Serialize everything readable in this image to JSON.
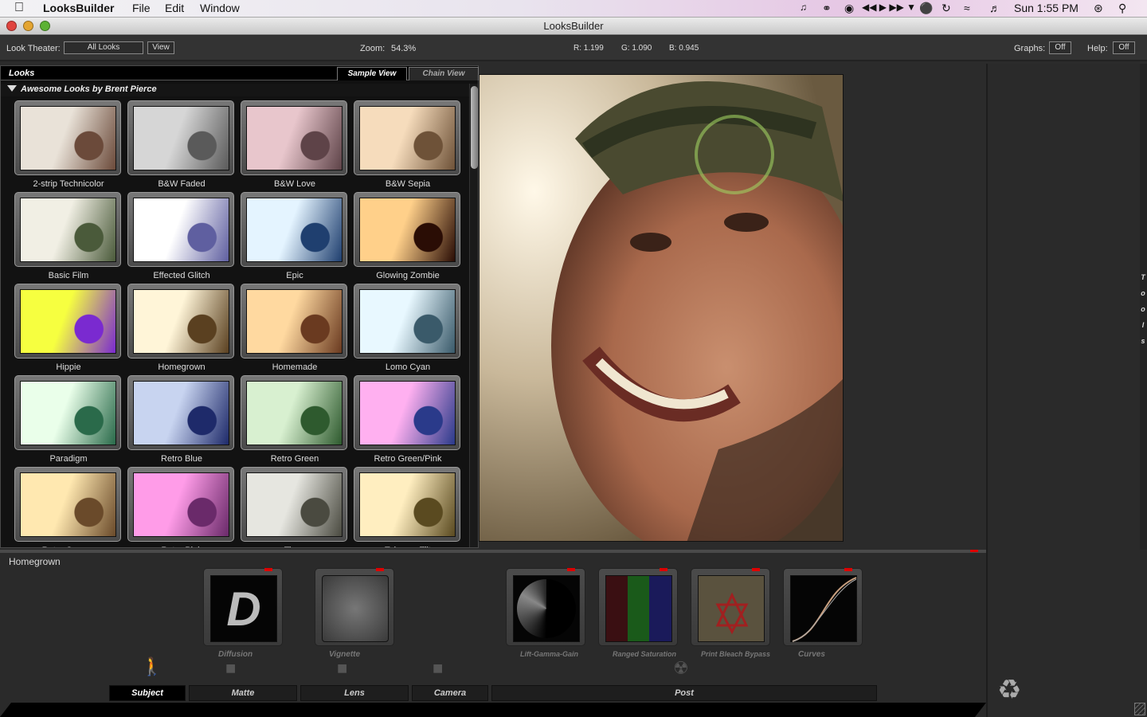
{
  "menubar": {
    "app_name": "LooksBuilder",
    "menus": [
      "File",
      "Edit",
      "Window"
    ],
    "clock": "Sun 1:55 PM"
  },
  "window": {
    "title": "LooksBuilder"
  },
  "toolbar": {
    "look_theater_label": "Look Theater:",
    "look_theater_value": "All Looks",
    "view_button": "View",
    "zoom_label": "Zoom:",
    "zoom_value": "54.3%",
    "r": "R: 1.199",
    "g": "G: 1.090",
    "b": "B: 0.945",
    "graphs_label": "Graphs:",
    "graphs_value": "Off",
    "help_label": "Help:",
    "help_value": "Off"
  },
  "looks_panel": {
    "title": "Looks",
    "tabs": [
      "Sample View",
      "Chain View"
    ],
    "active_tab": "Sample View",
    "group_title": "Awesome Looks by Brent Pierce",
    "looks": [
      {
        "name": "2-strip Technicolor",
        "c1": "#e9e2d8",
        "c2": "#6b4a3a"
      },
      {
        "name": "B&W Faded",
        "c1": "#d6d6d6",
        "c2": "#5a5a5a"
      },
      {
        "name": "B&W Love",
        "c1": "#e8c6cc",
        "c2": "#5e4348"
      },
      {
        "name": "B&W Sepia",
        "c1": "#f6dcbc",
        "c2": "#6e5238"
      },
      {
        "name": "Basic Film",
        "c1": "#f1efe4",
        "c2": "#4a5a3a"
      },
      {
        "name": "Effected Glitch",
        "c1": "#ffffff",
        "c2": "#5f5fa0"
      },
      {
        "name": "Epic",
        "c1": "#e4f4ff",
        "c2": "#1f3f6f"
      },
      {
        "name": "Glowing Zombie",
        "c1": "#ffd08a",
        "c2": "#2a0d05"
      },
      {
        "name": "Hippie",
        "c1": "#f6ff40",
        "c2": "#7a2ad0"
      },
      {
        "name": "Homegrown",
        "c1": "#fff5d8",
        "c2": "#5a4020"
      },
      {
        "name": "Homemade",
        "c1": "#ffd9a0",
        "c2": "#6a3a20"
      },
      {
        "name": "Lomo Cyan",
        "c1": "#e8f8ff",
        "c2": "#3a5a6a"
      },
      {
        "name": "Paradigm",
        "c1": "#eaffea",
        "c2": "#2a6a4a"
      },
      {
        "name": "Retro Blue",
        "c1": "#c8d4f0",
        "c2": "#1e2a6a"
      },
      {
        "name": "Retro Green",
        "c1": "#d8f0d0",
        "c2": "#2e5a2e"
      },
      {
        "name": "Retro Green/Pink",
        "c1": "#ffb0f0",
        "c2": "#2a3a8a"
      },
      {
        "name": "Retro Orange",
        "c1": "#ffe8b0",
        "c2": "#6a4a2a"
      },
      {
        "name": "Retro Pink",
        "c1": "#ff9ce8",
        "c2": "#6a2a6a"
      },
      {
        "name": "Tinny",
        "c1": "#e6e6e0",
        "c2": "#4a4a40"
      },
      {
        "name": "Tobacco Tilt",
        "c1": "#ffeec0",
        "c2": "#5a4a20"
      }
    ]
  },
  "current_look": "Homegrown",
  "chain": {
    "tools": [
      {
        "name": "Diffusion"
      },
      {
        "name": "Vignette"
      },
      {
        "name": "Lift-Gamma-Gain"
      },
      {
        "name": "Ranged Saturation"
      },
      {
        "name": "Print Bleach Bypass"
      },
      {
        "name": "Curves"
      }
    ],
    "categories": [
      "Subject",
      "Matte",
      "Lens",
      "Camera",
      "Post"
    ],
    "active_category": "Subject"
  },
  "right_panel": {
    "tools_label": [
      "T",
      "o",
      "o",
      "l",
      "s"
    ]
  }
}
